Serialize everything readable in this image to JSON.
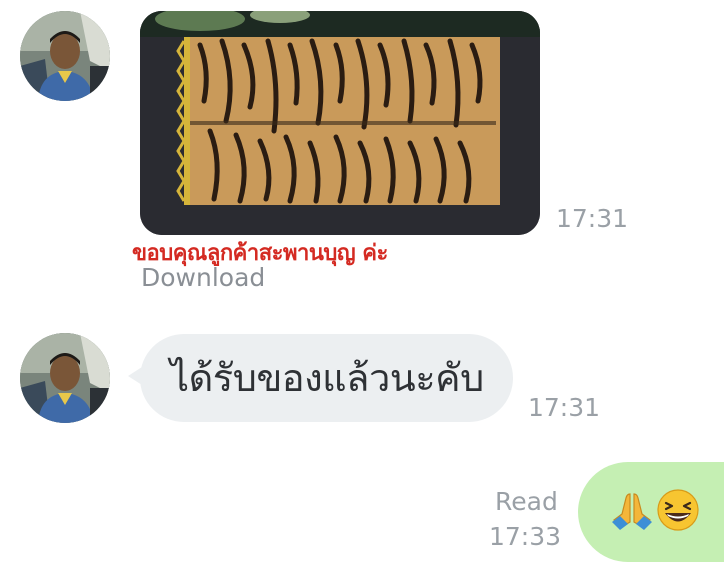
{
  "messages": [
    {
      "sender": "incoming",
      "type": "image",
      "time": "17:31",
      "caption": "ขอบคุณลูกค้าสะพานบุญ ค่ะ",
      "download_label": "Download"
    },
    {
      "sender": "incoming",
      "type": "text",
      "text": "ได้รับของแล้วนะคับ",
      "time": "17:31"
    },
    {
      "sender": "outgoing",
      "type": "emoji",
      "emojis": [
        "folded-hands-emoji",
        "grinning-squinting-face-emoji"
      ],
      "status": "Read",
      "time": "17:33"
    }
  ],
  "colors": {
    "incoming_bubble": "#eceff1",
    "outgoing_bubble": "#c5efb3",
    "caption_text": "#d42a22",
    "meta_text": "#9aa0a6"
  }
}
